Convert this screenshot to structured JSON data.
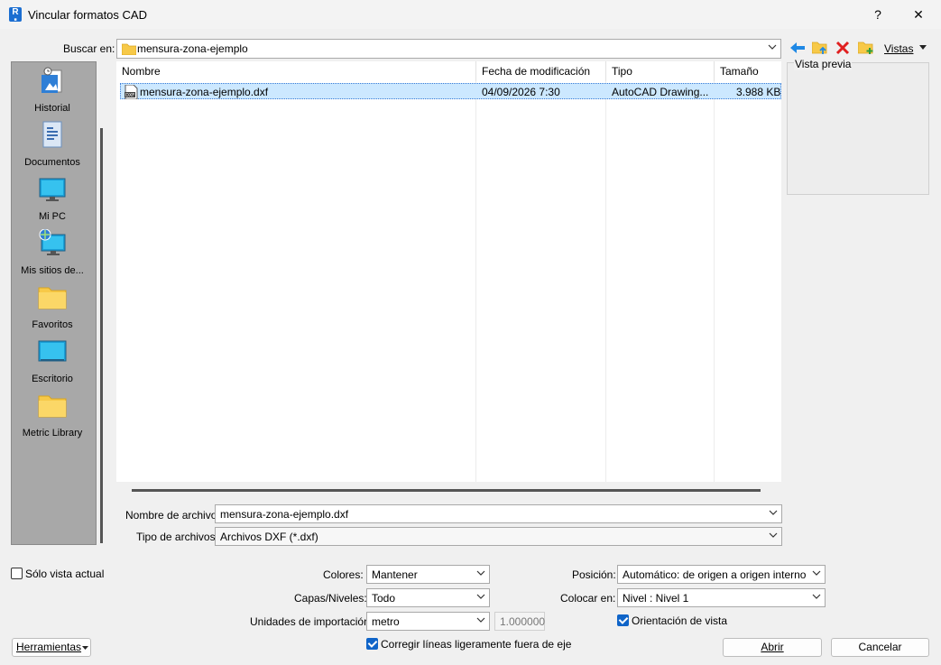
{
  "window": {
    "title": "Vincular formatos CAD",
    "help_label": "?",
    "close_label": "✕",
    "app_icon_letter": "R"
  },
  "lookin": {
    "label": "Buscar en:",
    "value": "mensura-zona-ejemplo"
  },
  "toolbar": {
    "views_label": "Vistas"
  },
  "places": [
    {
      "label": "Historial",
      "icon": "history-icon"
    },
    {
      "label": "Documentos",
      "icon": "documents-icon"
    },
    {
      "label": "Mi PC",
      "icon": "computer-icon"
    },
    {
      "label": "Mis sitios de...",
      "icon": "network-sites-icon"
    },
    {
      "label": "Favoritos",
      "icon": "folder-icon"
    },
    {
      "label": "Escritorio",
      "icon": "desktop-icon"
    },
    {
      "label": "Metric Library",
      "icon": "folder-icon"
    }
  ],
  "file_list": {
    "columns": [
      "Nombre",
      "Fecha de modificación",
      "Tipo",
      "Tamaño"
    ],
    "rows": [
      {
        "name": "mensura-zona-ejemplo.dxf",
        "date": "04/09/2026 7:30",
        "type": "AutoCAD Drawing...",
        "size": "3.988 KB",
        "selected": true
      }
    ]
  },
  "preview": {
    "label": "Vista previa"
  },
  "filename": {
    "label": "Nombre de archivo:",
    "value": "mensura-zona-ejemplo.dxf"
  },
  "filetype": {
    "label": "Tipo de archivos:",
    "value": "Archivos DXF  (*.dxf)"
  },
  "options": {
    "current_view_only": {
      "label": "Sólo vista actual",
      "checked": false
    },
    "colors": {
      "label": "Colores:",
      "value": "Mantener"
    },
    "layers": {
      "label": "Capas/Niveles:",
      "value": "Todo"
    },
    "import_units": {
      "label": "Unidades de importación:",
      "value": "metro",
      "factor": "1.000000"
    },
    "correct_lines": {
      "label": "Corregir líneas ligeramente fuera de eje",
      "checked": true
    },
    "position": {
      "label": "Posición:",
      "value": "Automático: de origen a origen interno"
    },
    "place_at": {
      "label": "Colocar en:",
      "value": "Nivel : Nivel 1"
    },
    "orient_to_view": {
      "label": "Orientación de vista",
      "checked": true
    }
  },
  "buttons": {
    "tools_label": "Herramientas",
    "open_label": "Abrir",
    "cancel_label": "Cancelar"
  },
  "colors": {
    "accent": "#0f64c8",
    "selection": "#cce8ff",
    "folder": "#f7c948",
    "delete_red": "#e02020"
  }
}
